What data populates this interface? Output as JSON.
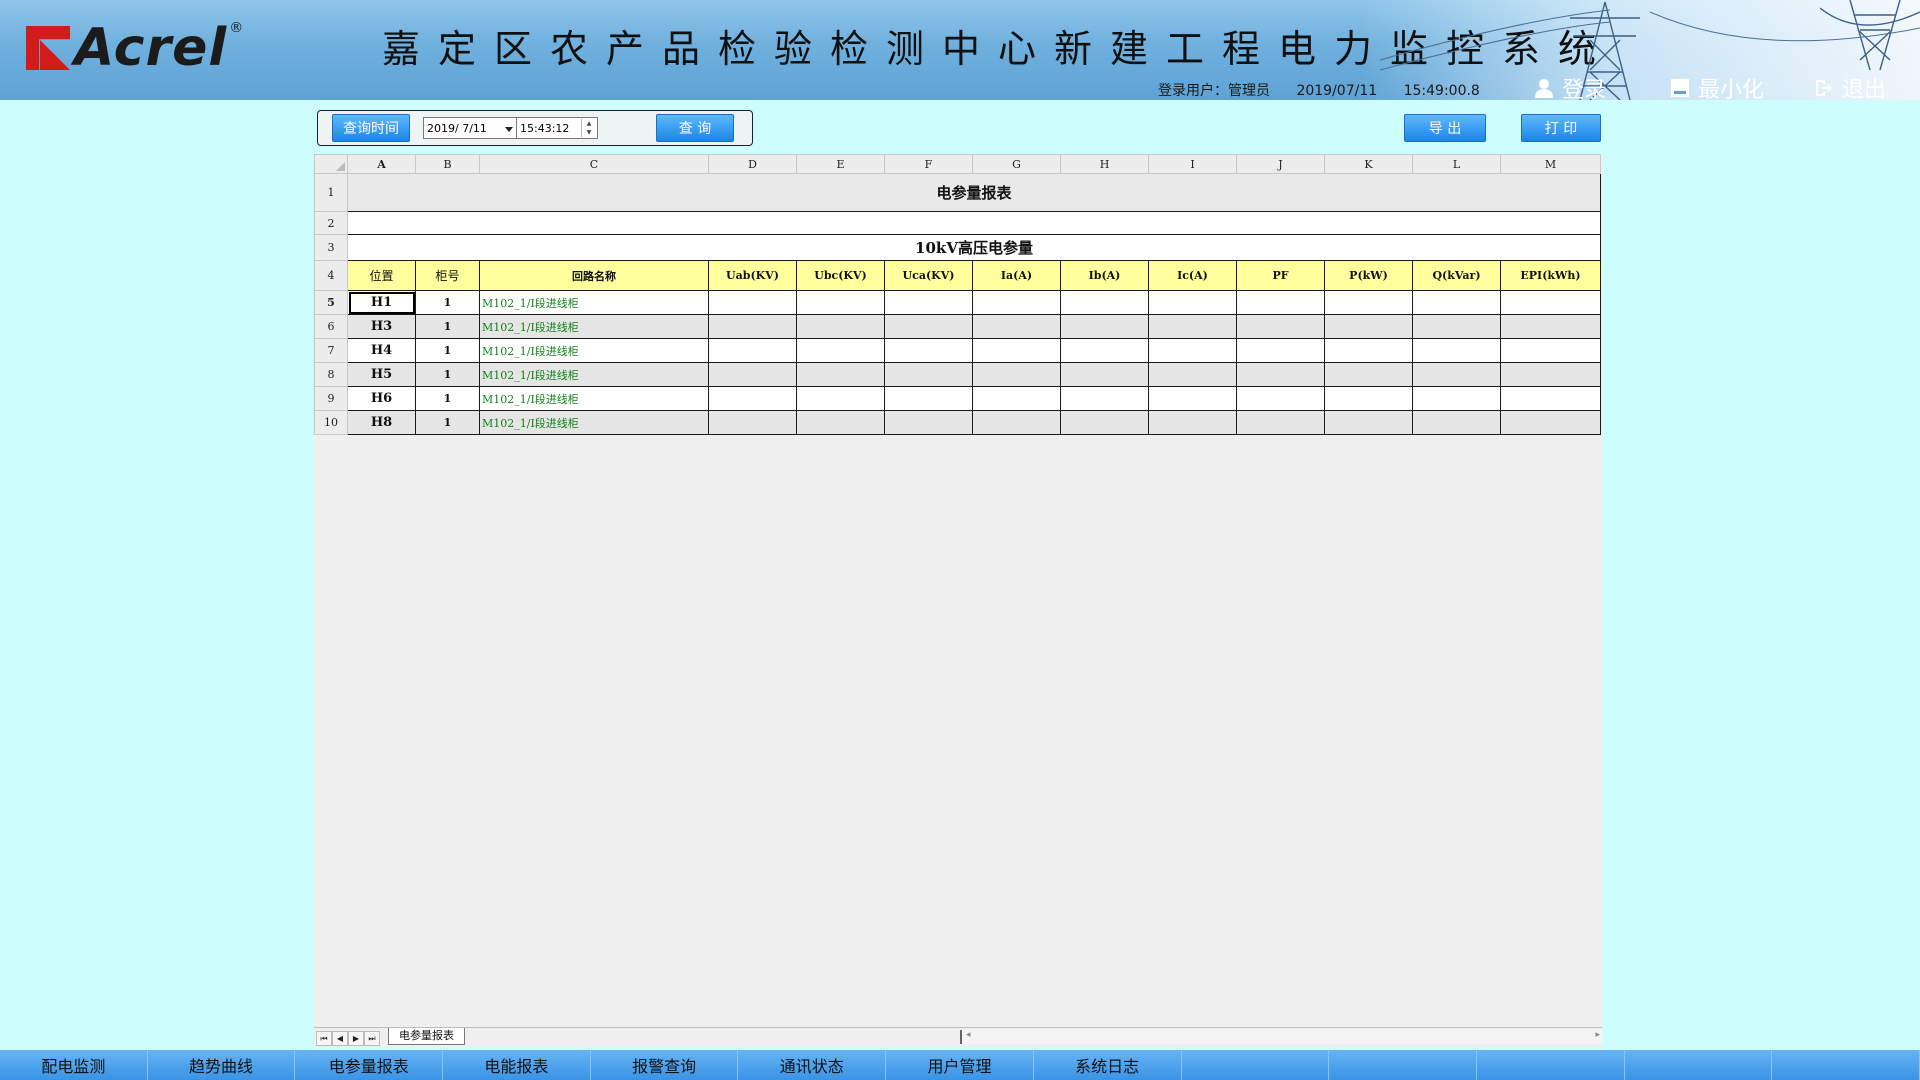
{
  "header": {
    "logo_text": "Acrel",
    "logo_reg": "®",
    "system_title": "嘉定区农产品检验检测中心新建工程电力监控系统",
    "user_label": "登录用户：",
    "user_name": "管理员",
    "date": "2019/07/11",
    "time": "15:49:00.8",
    "login_label": "登录",
    "minimize_label": "最小化",
    "exit_label": "退出"
  },
  "toolbar": {
    "query_time_label": "查询时间",
    "date_value": "2019/ 7/11",
    "time_value": "15:43:12",
    "query_label": "查 询",
    "export_label": "导 出",
    "print_label": "打 印"
  },
  "sheet": {
    "columns": [
      "A",
      "B",
      "C",
      "D",
      "E",
      "F",
      "G",
      "H",
      "I",
      "J",
      "K",
      "L",
      "M"
    ],
    "row_numbers": [
      "1",
      "2",
      "3",
      "4",
      "5",
      "6",
      "7",
      "8",
      "9",
      "10"
    ],
    "title": "电参量报表",
    "subtitle": "10kV高压电参量",
    "headers": [
      "位置",
      "柜号",
      "回路名称",
      "Uab(KV)",
      "Ubc(KV)",
      "Uca(KV)",
      "Ia(A)",
      "Ib(A)",
      "Ic(A)",
      "PF",
      "P(kW)",
      "Q(kVar)",
      "EPI(kWh)"
    ],
    "rows": [
      {
        "pos": "H1",
        "no": "1",
        "name": "M102_1/I段进线柜"
      },
      {
        "pos": "H3",
        "no": "1",
        "name": "M102_1/I段进线柜"
      },
      {
        "pos": "H4",
        "no": "1",
        "name": "M102_1/I段进线柜"
      },
      {
        "pos": "H5",
        "no": "1",
        "name": "M102_1/I段进线柜"
      },
      {
        "pos": "H6",
        "no": "1",
        "name": "M102_1/I段进线柜"
      },
      {
        "pos": "H8",
        "no": "1",
        "name": "M102_1/I段进线柜"
      }
    ],
    "tab_name": "电参量报表"
  },
  "bottom_nav": [
    "配电监测",
    "趋势曲线",
    "电参量报表",
    "电能报表",
    "报警查询",
    "通讯状态",
    "用户管理",
    "系统日志",
    "",
    "",
    "",
    "",
    ""
  ]
}
